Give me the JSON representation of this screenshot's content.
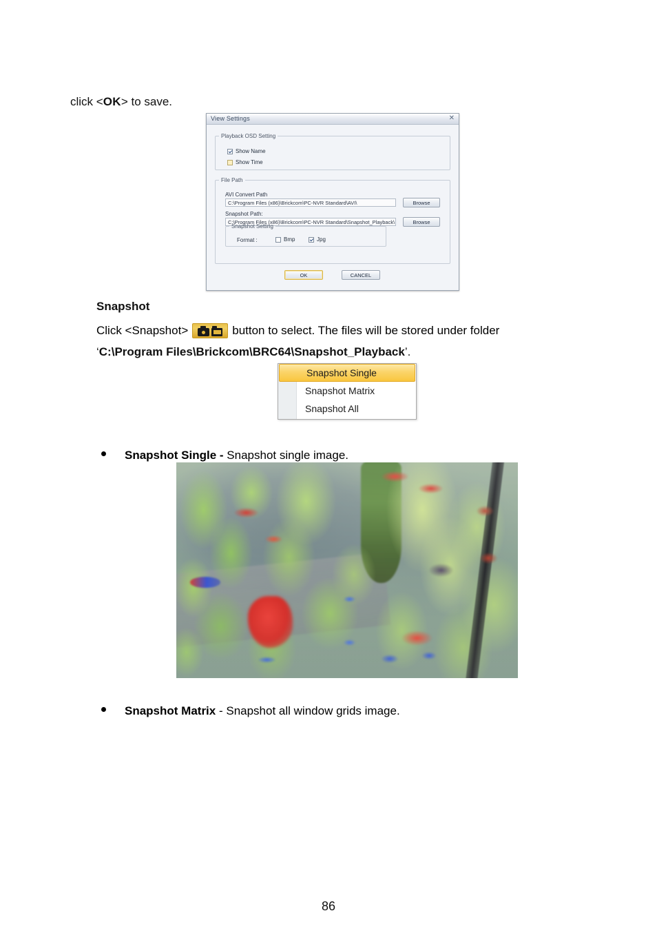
{
  "document": {
    "page_number": "86",
    "intro": {
      "prefix": "click <",
      "emphasis": "OK",
      "suffix": "> to save."
    }
  },
  "dialog": {
    "title": "View Settings",
    "close_icon": "close-icon",
    "osd_group": {
      "legend": "Playback OSD Setting",
      "checkboxes": [
        {
          "label": "Show Name",
          "checked": true
        },
        {
          "label": "Show Time",
          "checked": false
        }
      ]
    },
    "file_path_group": {
      "legend": "File Path",
      "avi_label": "AVI Convert Path",
      "avi_value": "C:\\Program Files (x86)\\Brickcom\\PC-NVR Standard\\AVI\\",
      "avi_browse": "Browse",
      "snapshot_label": "Snapshot Path:",
      "snapshot_value": "C:\\Program Files (x86)\\Brickcom\\PC-NVR Standard\\Snapshot_Playback\\",
      "snapshot_browse": "Browse",
      "snapshot_setting": {
        "legend": "Snapshot Setting",
        "format_label": "Format :",
        "formats": [
          {
            "label": "Bmp",
            "checked": false
          },
          {
            "label": "Jpg",
            "checked": true
          }
        ]
      }
    },
    "buttons": {
      "ok": "OK",
      "cancel": "CANCEL"
    }
  },
  "snapshot_section": {
    "heading": "Snapshot",
    "click_prefix": "Click <Snapshot>",
    "icon_name": "snapshot-camera-icon",
    "click_suffix": "button to select. The files will be stored under folder",
    "path_open_quote": "‘",
    "path": "C:\\Program Files\\Brickcom\\BRC64\\Snapshot_Playback",
    "path_close_quote": "’.",
    "menu": {
      "items": [
        {
          "label": "Snapshot Single",
          "selected": true
        },
        {
          "label": "Snapshot Matrix",
          "selected": false
        },
        {
          "label": "Snapshot All",
          "selected": false
        }
      ]
    },
    "bullets": [
      {
        "term": "Snapshot Single",
        "separator": " - ",
        "description": "Snapshot single image."
      },
      {
        "term": "Snapshot Matrix",
        "separator": " - ",
        "description": "Snapshot all window grids image."
      }
    ]
  },
  "photo": {
    "caption_name": "aquarium-screenshot",
    "description": "Aquarium scene with green aquatic plants, red and blue fish"
  },
  "colors": {
    "accent_gold": "#f9c63f",
    "icon_button_gold": "#e8c04a",
    "dialog_bg": "#f2f4f8"
  }
}
